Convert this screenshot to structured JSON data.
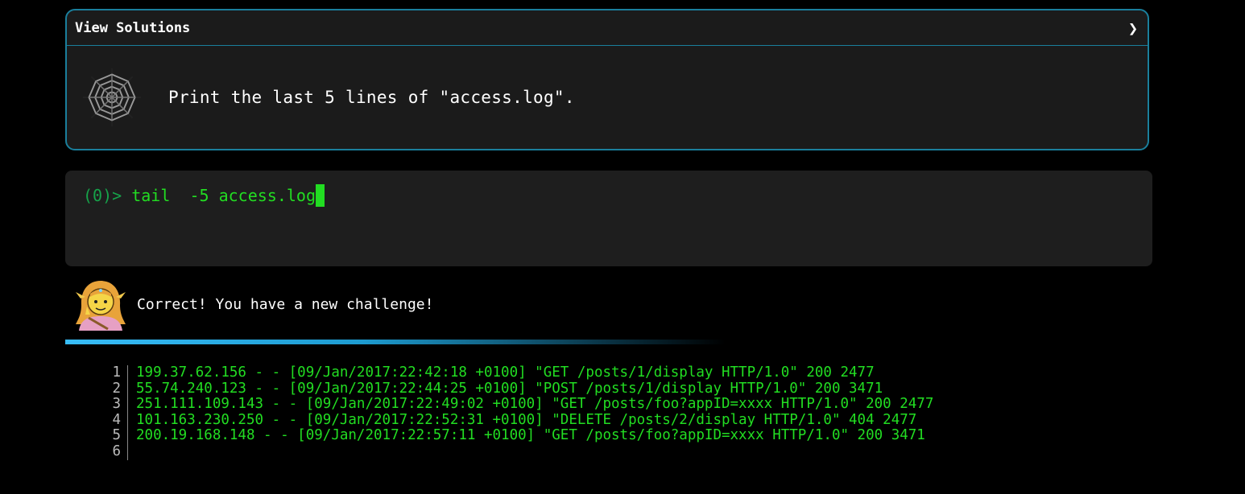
{
  "solutions": {
    "title": "View Solutions",
    "chevron": "❯",
    "task_text": "Print the last 5 lines of \"access.log\"."
  },
  "terminal": {
    "prompt": "(0)>",
    "command": "tail  -5 access.log"
  },
  "feedback": {
    "message": "Correct! You have a new challenge!"
  },
  "output": {
    "line_numbers": [
      "1",
      "2",
      "3",
      "4",
      "5",
      "6"
    ],
    "lines": [
      "199.37.62.156 - - [09/Jan/2017:22:42:18 +0100] \"GET /posts/1/display HTTP/1.0\" 200 2477",
      "55.74.240.123 - - [09/Jan/2017:22:44:25 +0100] \"POST /posts/1/display HTTP/1.0\" 200 3471",
      "251.111.109.143 - - [09/Jan/2017:22:49:02 +0100] \"GET /posts/foo?appID=xxxx HTTP/1.0\" 200 2477",
      "101.163.230.250 - - [09/Jan/2017:22:52:31 +0100] \"DELETE /posts/2/display HTTP/1.0\" 404 2477",
      "200.19.168.148 - - [09/Jan/2017:22:57:11 +0100] \"GET /posts/foo?appID=xxxx HTTP/1.0\" 200 3471",
      ""
    ]
  },
  "colors": {
    "accent_border": "#1a7f9c",
    "terminal_green": "#22dd22",
    "divider_blue": "#38bdf8"
  },
  "icons": {
    "solutions_icon": "spider-web-icon",
    "feedback_avatar": "elf-avatar-icon",
    "expand_icon": "chevron-right-icon"
  }
}
